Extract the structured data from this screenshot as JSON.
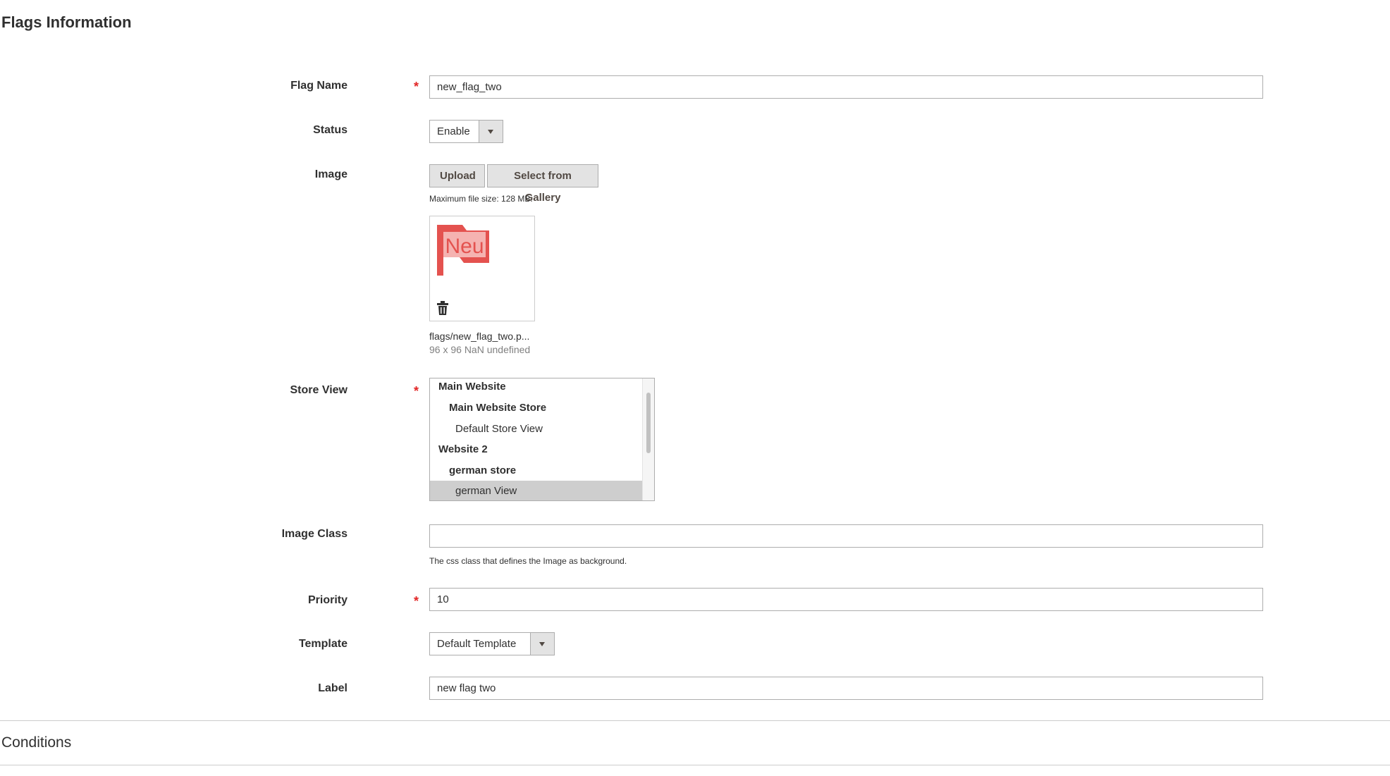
{
  "sections": {
    "flags_information": "Flags Information",
    "conditions": "Conditions"
  },
  "fields": {
    "flag_name": {
      "label": "Flag Name",
      "value": "new_flag_two"
    },
    "status": {
      "label": "Status",
      "value": "Enable"
    },
    "image": {
      "label": "Image",
      "upload_label": "Upload",
      "gallery_label": "Select from Gallery",
      "max_size_note": "Maximum file size: 128 MB.",
      "file_name": "flags/new_flag_two.p...",
      "file_meta": "96 x 96 NaN undefined",
      "preview_text": "Neu"
    },
    "store_view": {
      "label": "Store View",
      "options": [
        {
          "label": "Main Website"
        },
        {
          "label": "Main Website Store"
        },
        {
          "label": "Default Store View"
        },
        {
          "label": "Website 2"
        },
        {
          "label": "german store"
        },
        {
          "label": "german View",
          "selected": true
        }
      ]
    },
    "image_class": {
      "label": "Image Class",
      "value": "",
      "note": "The css class that defines the Image as background."
    },
    "priority": {
      "label": "Priority",
      "value": "10"
    },
    "template": {
      "label": "Template",
      "value": "Default Template"
    },
    "label": {
      "label": "Label",
      "value": "new flag two"
    }
  },
  "colors": {
    "required": "#e22626",
    "flag": "#e4524f",
    "selected_option": "#cecece"
  },
  "icons": {
    "delete": "trash-icon",
    "dropdown": "chevron-down-icon"
  }
}
